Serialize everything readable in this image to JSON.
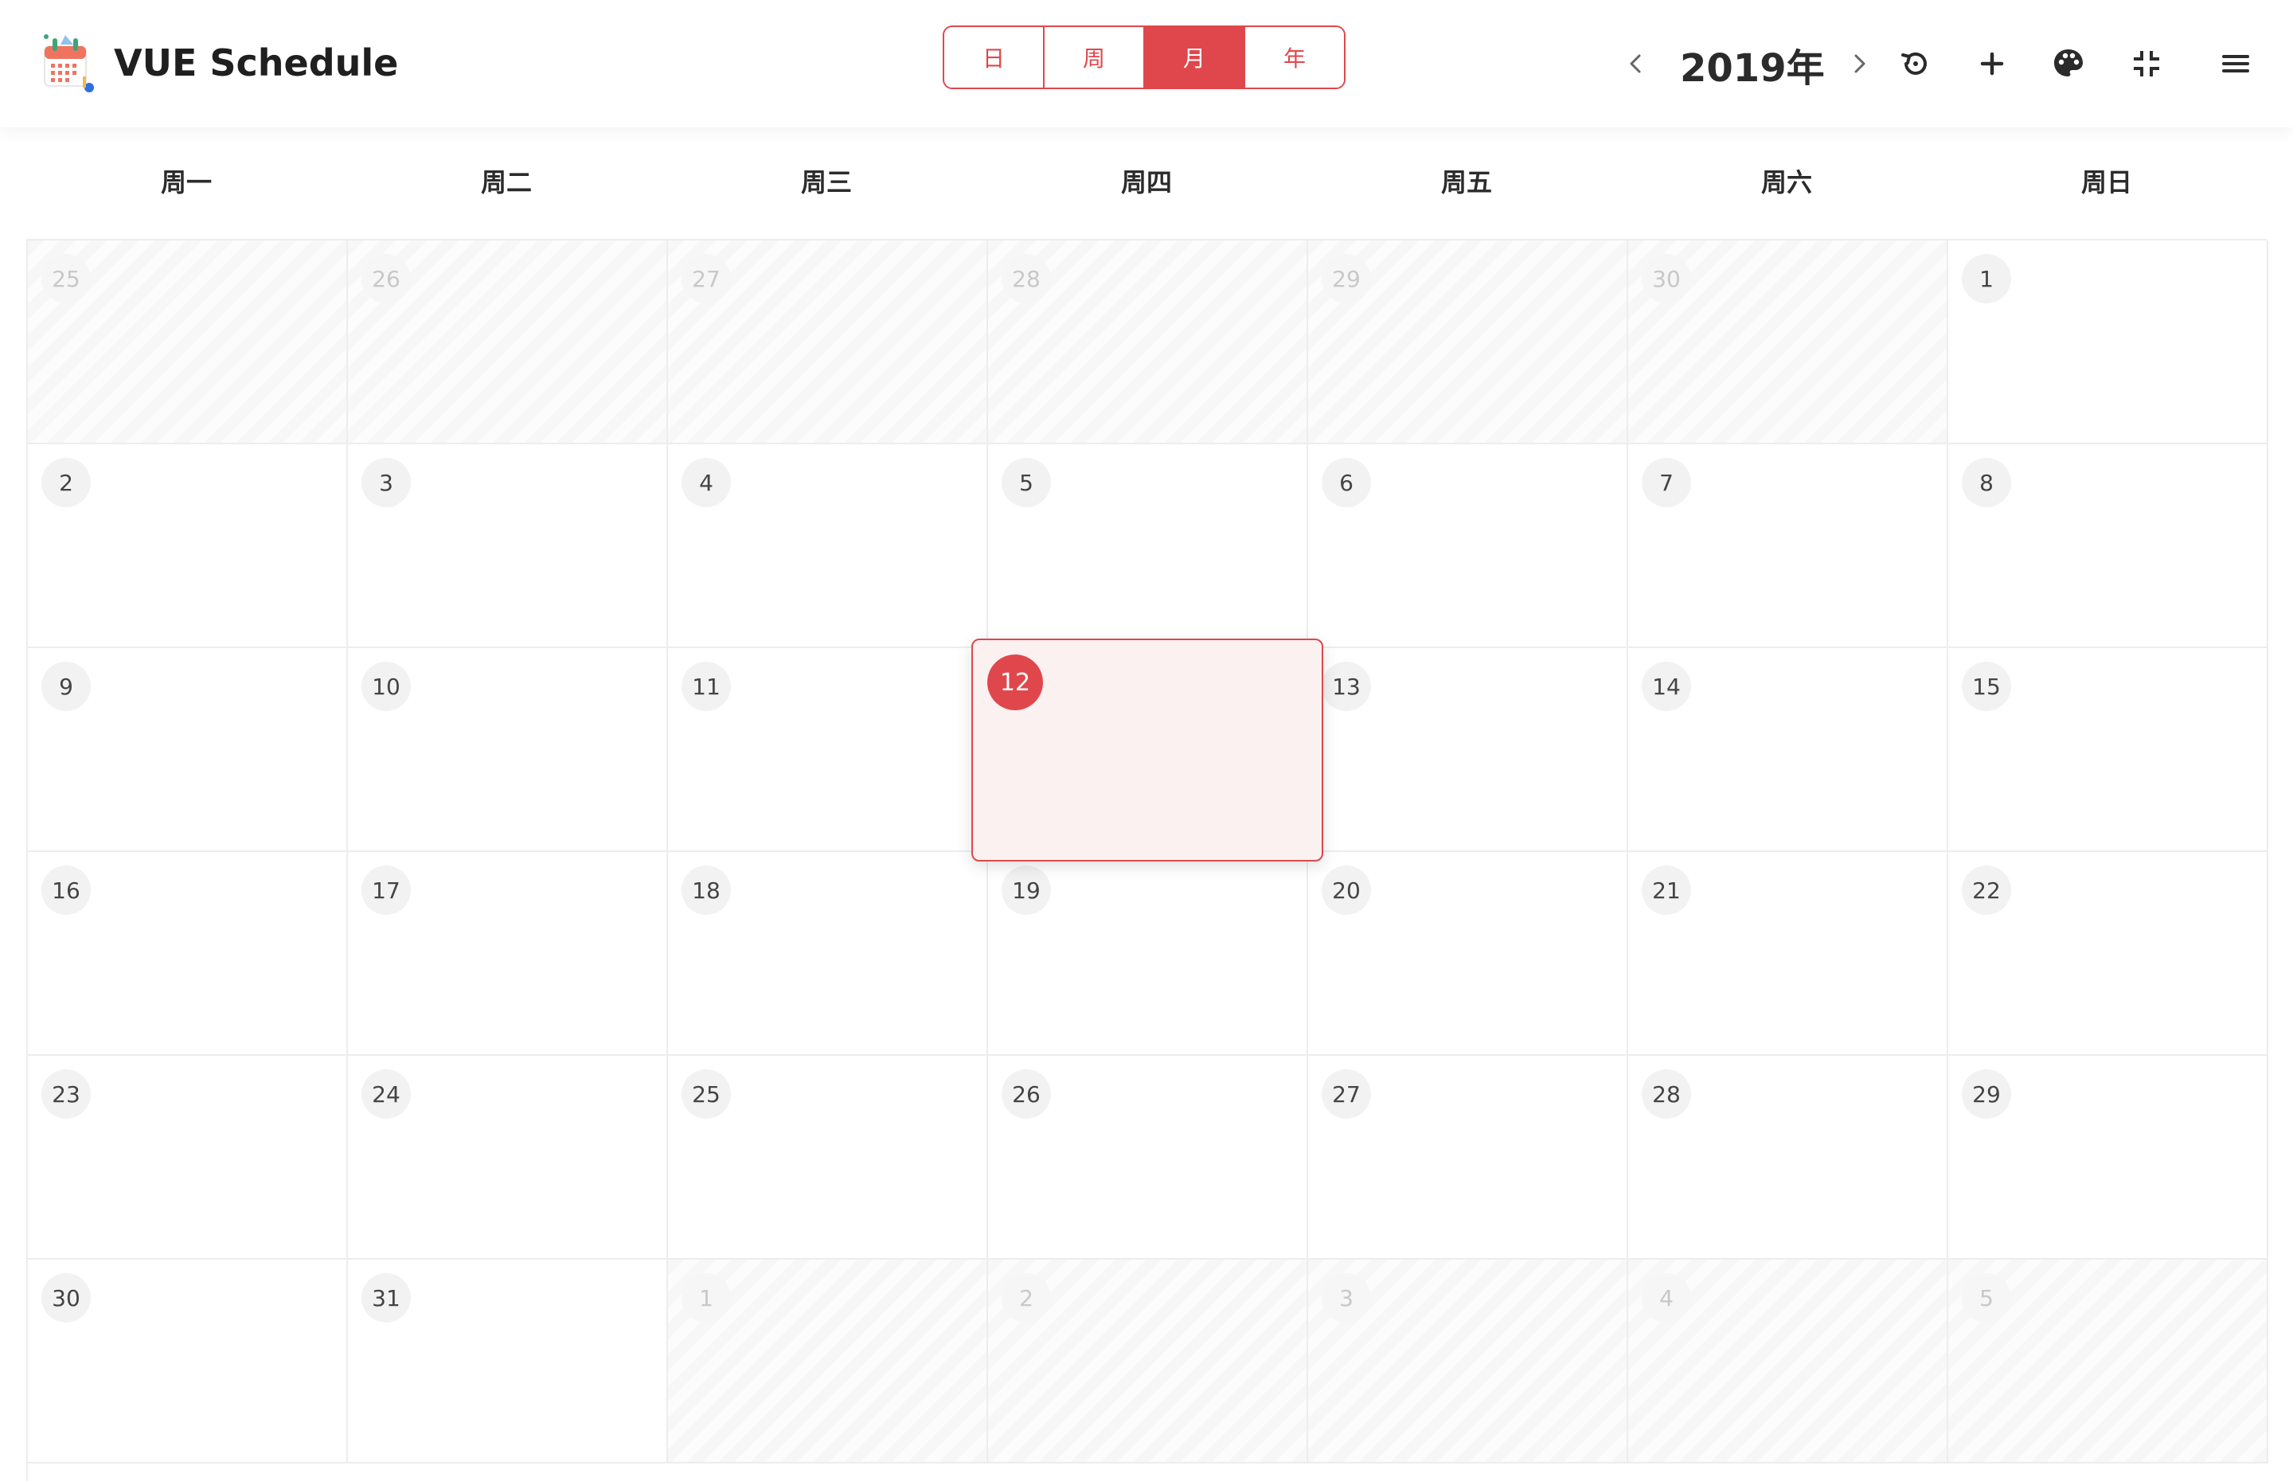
{
  "header": {
    "title": "VUE Schedule",
    "views": [
      {
        "label": "日",
        "active": false
      },
      {
        "label": "周",
        "active": false
      },
      {
        "label": "月",
        "active": true
      },
      {
        "label": "年",
        "active": false
      }
    ],
    "year_label": "2019年",
    "icons": {
      "prev": "chevron-left-icon",
      "next": "chevron-right-icon",
      "reset": "history-icon",
      "add": "plus-icon",
      "theme": "palette-icon",
      "collapse": "compress-icon",
      "menu": "hamburger-menu-icon"
    },
    "accent_color": "#e0474c"
  },
  "weekdays": [
    "周一",
    "周二",
    "周三",
    "周四",
    "周五",
    "周六",
    "周日"
  ],
  "weeks": [
    [
      {
        "day": "25",
        "other": true
      },
      {
        "day": "26",
        "other": true
      },
      {
        "day": "27",
        "other": true
      },
      {
        "day": "28",
        "other": true
      },
      {
        "day": "29",
        "other": true
      },
      {
        "day": "30",
        "other": true
      },
      {
        "day": "1",
        "other": false
      }
    ],
    [
      {
        "day": "2",
        "other": false
      },
      {
        "day": "3",
        "other": false
      },
      {
        "day": "4",
        "other": false
      },
      {
        "day": "5",
        "other": false
      },
      {
        "day": "6",
        "other": false
      },
      {
        "day": "7",
        "other": false
      },
      {
        "day": "8",
        "other": false
      }
    ],
    [
      {
        "day": "9",
        "other": false
      },
      {
        "day": "10",
        "other": false
      },
      {
        "day": "11",
        "other": false
      },
      {
        "day": "12",
        "other": false,
        "selected": true
      },
      {
        "day": "13",
        "other": false
      },
      {
        "day": "14",
        "other": false
      },
      {
        "day": "15",
        "other": false
      }
    ],
    [
      {
        "day": "16",
        "other": false
      },
      {
        "day": "17",
        "other": false
      },
      {
        "day": "18",
        "other": false
      },
      {
        "day": "19",
        "other": false
      },
      {
        "day": "20",
        "other": false
      },
      {
        "day": "21",
        "other": false
      },
      {
        "day": "22",
        "other": false
      }
    ],
    [
      {
        "day": "23",
        "other": false
      },
      {
        "day": "24",
        "other": false
      },
      {
        "day": "25",
        "other": false
      },
      {
        "day": "26",
        "other": false
      },
      {
        "day": "27",
        "other": false
      },
      {
        "day": "28",
        "other": false
      },
      {
        "day": "29",
        "other": false
      }
    ],
    [
      {
        "day": "30",
        "other": false
      },
      {
        "day": "31",
        "other": false
      },
      {
        "day": "1",
        "other": true
      },
      {
        "day": "2",
        "other": true
      },
      {
        "day": "3",
        "other": true
      },
      {
        "day": "4",
        "other": true
      },
      {
        "day": "5",
        "other": true
      }
    ]
  ],
  "selected_day": "12"
}
